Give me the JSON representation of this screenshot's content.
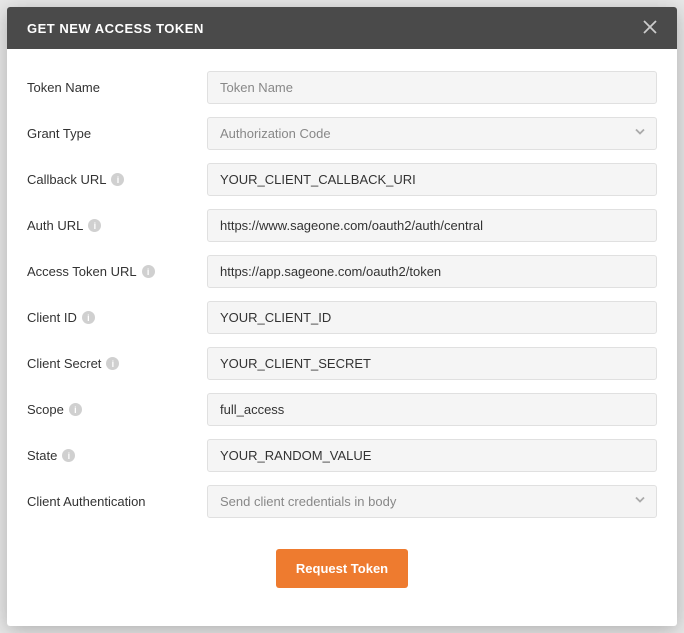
{
  "header": {
    "title": "GET NEW ACCESS TOKEN"
  },
  "fields": {
    "token_name": {
      "label": "Token Name",
      "placeholder": "Token Name",
      "value": ""
    },
    "grant_type": {
      "label": "Grant Type",
      "selected": "Authorization Code"
    },
    "callback_url": {
      "label": "Callback URL",
      "value": "YOUR_CLIENT_CALLBACK_URI"
    },
    "auth_url": {
      "label": "Auth URL",
      "value": "https://www.sageone.com/oauth2/auth/central"
    },
    "access_token_url": {
      "label": "Access Token URL",
      "value": "https://app.sageone.com/oauth2/token"
    },
    "client_id": {
      "label": "Client ID",
      "value": "YOUR_CLIENT_ID"
    },
    "client_secret": {
      "label": "Client Secret",
      "value": "YOUR_CLIENT_SECRET"
    },
    "scope": {
      "label": "Scope",
      "value": "full_access"
    },
    "state": {
      "label": "State",
      "value": "YOUR_RANDOM_VALUE"
    },
    "client_auth": {
      "label": "Client Authentication",
      "selected": "Send client credentials in body"
    }
  },
  "buttons": {
    "request": "Request Token"
  }
}
